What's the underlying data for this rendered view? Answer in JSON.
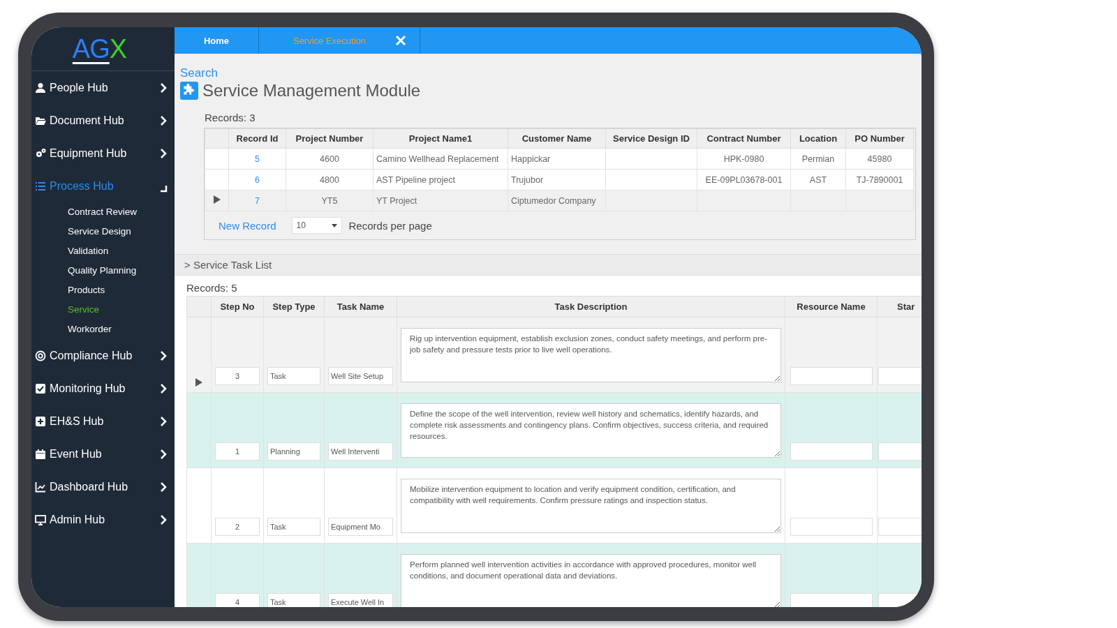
{
  "logo": {
    "part_1": "AG",
    "part_2": "X"
  },
  "sidebar": {
    "items": [
      {
        "label": "People Hub",
        "selected": false,
        "expanded": false
      },
      {
        "label": "Document Hub",
        "selected": false,
        "expanded": false
      },
      {
        "label": "Equipment Hub",
        "selected": false,
        "expanded": false
      },
      {
        "label": "Process Hub",
        "selected": true,
        "expanded": true,
        "children": [
          {
            "label": "Contract Review",
            "selected": false
          },
          {
            "label": "Service Design",
            "selected": false
          },
          {
            "label": "Validation",
            "selected": false
          },
          {
            "label": "Quality Planning",
            "selected": false
          },
          {
            "label": "Products",
            "selected": false
          },
          {
            "label": "Service",
            "selected": true
          },
          {
            "label": "Workorder",
            "selected": false
          }
        ]
      },
      {
        "label": "Compliance Hub",
        "selected": false,
        "expanded": false
      },
      {
        "label": "Monitoring Hub",
        "selected": false,
        "expanded": false
      },
      {
        "label": "EH&S Hub",
        "selected": false,
        "expanded": false
      },
      {
        "label": "Event Hub",
        "selected": false,
        "expanded": false
      },
      {
        "label": "Dashboard Hub",
        "selected": false,
        "expanded": false
      },
      {
        "label": "Admin Hub",
        "selected": false,
        "expanded": false
      }
    ]
  },
  "tabs": [
    {
      "label": "Home",
      "selected": false,
      "closable": false
    },
    {
      "label": "Service Execution",
      "selected": true,
      "closable": true
    }
  ],
  "search_link": "Search",
  "page_title": "Service Management Module",
  "records_table": {
    "records_label": "Records:",
    "records_count": "3",
    "columns": [
      "Record Id",
      "Project Number",
      "Project Name1",
      "Customer Name",
      "Service Design ID",
      "Contract Number",
      "Location",
      "PO Number"
    ],
    "rows": [
      {
        "current": false,
        "cells": [
          "5",
          "4600",
          "Camino Wellhead Replacement",
          "Happickar",
          "",
          "HPK-0980",
          "Permian",
          "45980"
        ]
      },
      {
        "current": false,
        "cells": [
          "6",
          "4800",
          "AST Pipeline project",
          "Trujubor",
          "",
          "EE-09PL03678-001",
          "AST",
          "TJ-7890001"
        ]
      },
      {
        "current": true,
        "cells": [
          "7",
          "YT5",
          "YT Project",
          "Ciptumedor Company",
          "",
          "",
          "",
          ""
        ]
      }
    ],
    "new_record": "New Record",
    "page_size": "10",
    "per_page_label": "Records per page"
  },
  "task_section": {
    "title": "> Service Task List",
    "records_label": "Records:",
    "records_count": "5",
    "columns": [
      "Step No",
      "Step Type",
      "Task Name",
      "Task Description",
      "Resource Name",
      "Star"
    ],
    "rows": [
      {
        "current": true,
        "step_no": "3",
        "step_type": "Task",
        "task_name": "Well Site Setup",
        "description": "Rig up intervention equipment, establish exclusion zones, conduct safety meetings, and perform pre-job safety and pressure tests prior to live well operations."
      },
      {
        "current": false,
        "step_no": "1",
        "step_type": "Planning",
        "task_name": "Well Interventi",
        "description": "Define the scope of the well intervention, review well history and schematics, identify hazards, and complete risk assessments and contingency plans. Confirm objectives, success criteria, and required resources."
      },
      {
        "current": false,
        "step_no": "2",
        "step_type": "Task",
        "task_name": "Equipment Mo",
        "description": "Mobilize intervention equipment to location and verify equipment condition, certification, and compatibility with well requirements. Confirm pressure ratings and inspection status."
      },
      {
        "current": false,
        "step_no": "4",
        "step_type": "Task",
        "task_name": "Execute Well In",
        "description": "Perform planned well intervention activities in accordance with approved procedures, monitor well conditions, and document operational data and deviations."
      }
    ]
  }
}
